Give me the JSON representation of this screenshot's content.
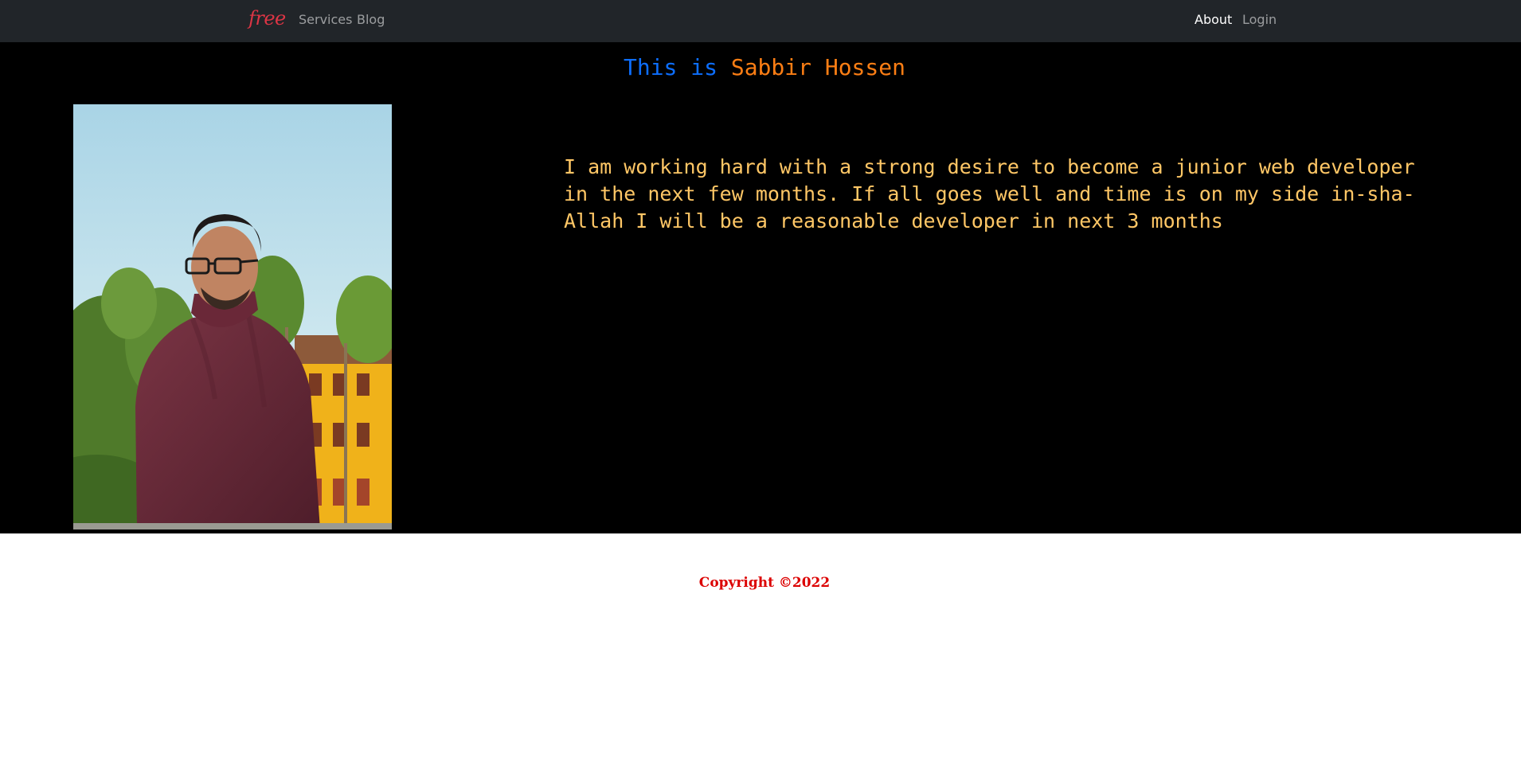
{
  "nav": {
    "brand": "free",
    "links": [
      {
        "label": "Services"
      },
      {
        "label": "Blog"
      },
      {
        "label": "About"
      },
      {
        "label": "Login"
      }
    ]
  },
  "hero": {
    "title_prefix": "This is ",
    "title_name": "Sabbir Hossen",
    "bio": "I am working hard with a strong desire to become a junior web developer in the next few months. If all goes well and time is on my side in-sha-Allah I will be a reasonable developer in next 3 months"
  },
  "footer": {
    "copyright": "Copyright ©2022"
  },
  "colors": {
    "navbar_bg": "#212529",
    "brand": "#dc3545",
    "title_prefix": "#0d6efd",
    "title_name": "#fd7e14",
    "bio": "#ffc766",
    "footer": "#dc0000"
  }
}
